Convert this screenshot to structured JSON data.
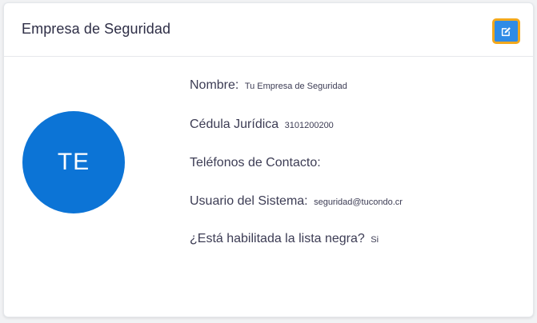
{
  "header": {
    "title": "Empresa de Seguridad"
  },
  "avatar": {
    "initials": "TE",
    "color": "#0c74d6"
  },
  "edit_button": {
    "icon": "edit-icon",
    "color": "#2f8be6",
    "focus_ring_color": "#f2a81d"
  },
  "fields": {
    "nombre": {
      "label": "Nombre:",
      "value": "Tu Empresa de Seguridad"
    },
    "cedula": {
      "label": "Cédula Jurídica",
      "value": "3101200200"
    },
    "telefonos": {
      "label": "Teléfonos de Contacto:",
      "value": ""
    },
    "usuario": {
      "label": "Usuario del Sistema:",
      "value": "seguridad@tucondo.cr"
    },
    "lista_negra": {
      "label": "¿Está habilitada la lista negra?",
      "value": "Si"
    }
  }
}
